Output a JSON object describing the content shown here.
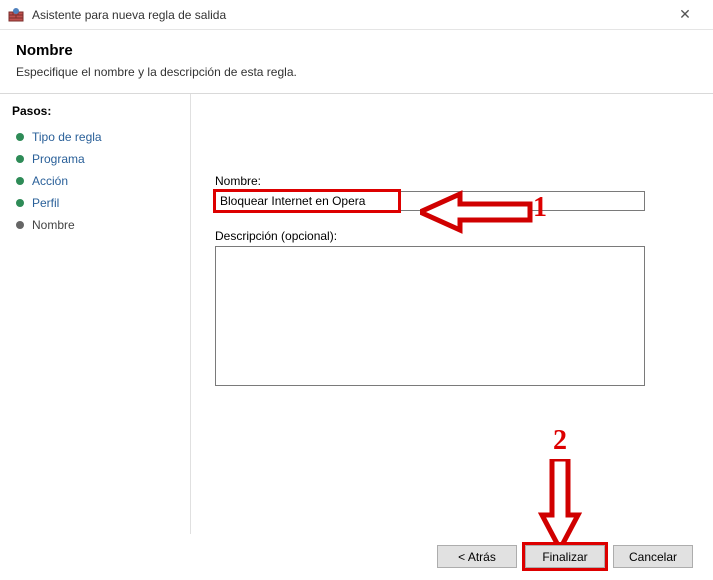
{
  "window": {
    "title": "Asistente para nueva regla de salida"
  },
  "header": {
    "title": "Nombre",
    "subtitle": "Especifique el nombre y la descripción de esta regla."
  },
  "sidebar": {
    "steps_label": "Pasos:",
    "items": [
      {
        "label": "Tipo de regla",
        "current": false
      },
      {
        "label": "Programa",
        "current": false
      },
      {
        "label": "Acción",
        "current": false
      },
      {
        "label": "Perfil",
        "current": false
      },
      {
        "label": "Nombre",
        "current": true
      }
    ]
  },
  "form": {
    "name_label": "Nombre:",
    "name_value": "Bloquear Internet en Opera",
    "desc_label": "Descripción (opcional):",
    "desc_value": ""
  },
  "footer": {
    "back": "< Atrás",
    "finish": "Finalizar",
    "cancel": "Cancelar"
  },
  "annotations": {
    "label1": "1",
    "label2": "2",
    "color": "#d00000"
  }
}
